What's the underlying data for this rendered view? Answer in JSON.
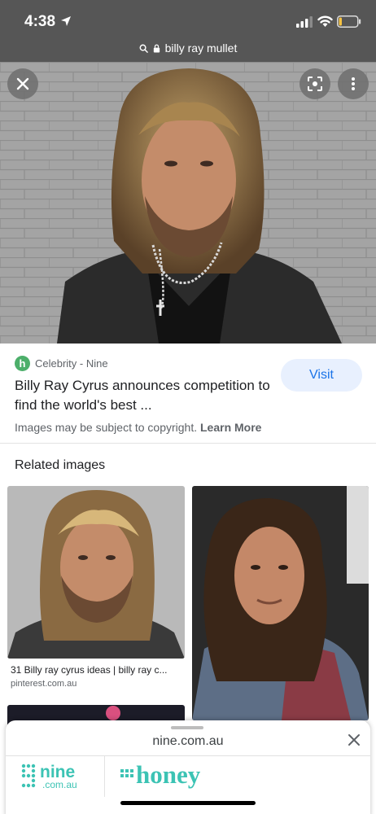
{
  "status_bar": {
    "time": "4:38"
  },
  "url_bar": {
    "url": "billy ray mullet"
  },
  "result": {
    "source_letter": "h",
    "source": "Celebrity - Nine",
    "title": "Billy Ray Cyrus announces competition to find the world's best ...",
    "visit_label": "Visit",
    "copyright_text": "Images may be subject to copyright.",
    "learn_more": "Learn More"
  },
  "related": {
    "heading": "Related images",
    "items": [
      {
        "caption": "31 Billy ray cyrus ideas | billy ray c...",
        "domain": "pinterest.com.au"
      },
      {
        "caption": "",
        "domain": ""
      }
    ]
  },
  "sheet": {
    "url": "nine.com.au",
    "logo_nine": "nine",
    "logo_nine_sub": ".com.au",
    "logo_honey": "honey"
  },
  "colors": {
    "accent": "#1a73e8",
    "visit_bg": "#e8f0fe",
    "favicon": "#4caf6a",
    "nine_brand": "#3cc3b4"
  }
}
